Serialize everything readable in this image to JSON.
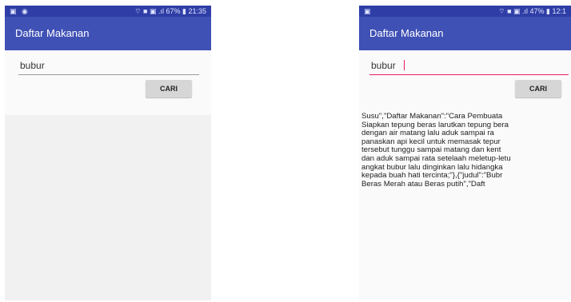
{
  "left_screen": {
    "status_left": "▣ ◉",
    "status_right": "⌔ ■ ▣ .ıl 67% ▮ 21:35",
    "app_title": "Daftar Makanan",
    "search_value": "bubur",
    "button_label": "CARI"
  },
  "right_screen": {
    "status_left": "▣",
    "status_right": "⌔ ■ ▣ .ıl 47% ▮ 12:1",
    "app_title": "Daftar Makanan",
    "search_value": "bubur",
    "button_label": "CARI",
    "result_lines": [
      "Susu\",\"Daftar   Makanan\":\"Cara   Pembuata",
      "Siapkan tepung beras larutkan tepung bera",
      "dengan  air  matang  lalu  aduk  sampai  ra",
      "panaskan api kecil untuk memasak tepur",
      "tersebut tunggu sampai matang dan kent",
      "dan aduk sampai rata setelaah meletup-letu",
      "angkat bubur lalu dinginkan lalu hidangka",
      "kepada  buah  hati  tercinta;\"},{\"judul\":\"Bubr",
      "Beras    Merah    atau    Beras    putih\",\"Daft"
    ]
  }
}
